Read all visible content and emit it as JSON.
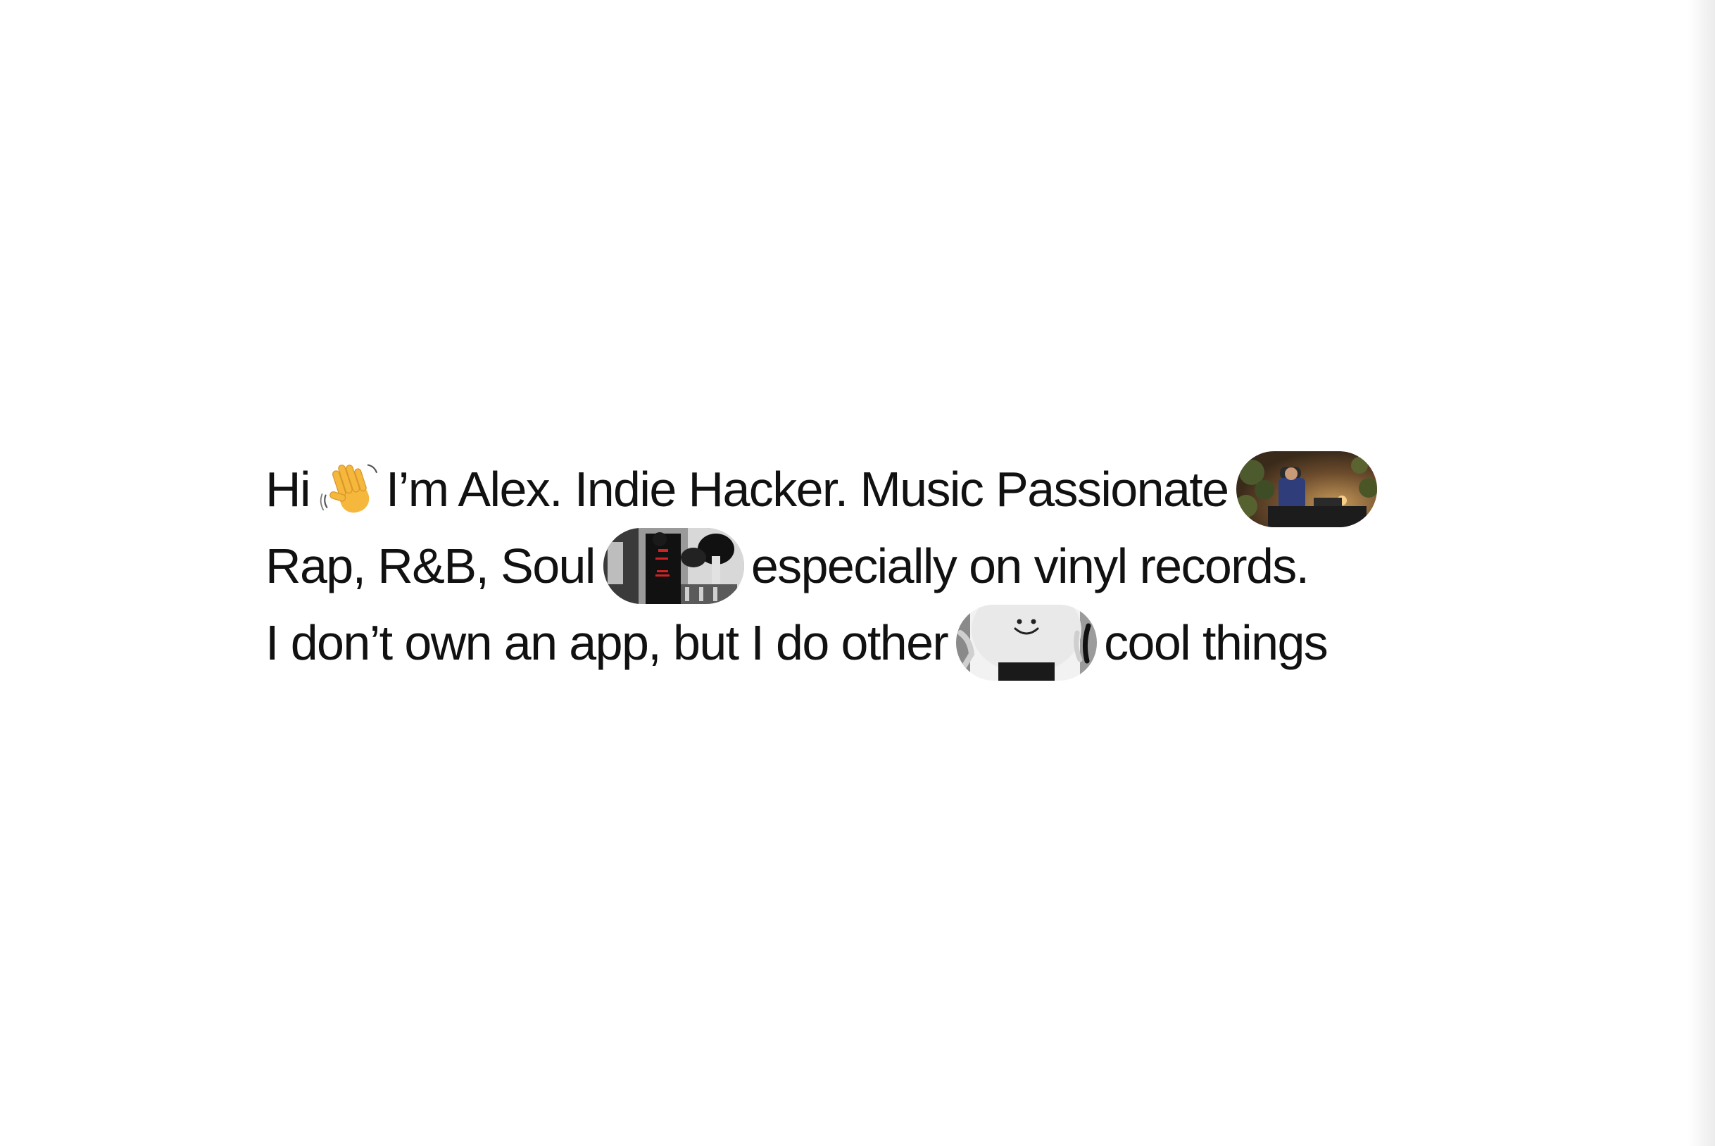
{
  "intro": {
    "line1": {
      "greeting": "Hi",
      "wave_icon": "waving-hand-icon",
      "text": "I’m Alex. Indie Hacker. Music Passionate",
      "image": "dj-booth-photo"
    },
    "line2": {
      "text_before": "Rap, R&B, Soul",
      "image": "vinyl-shop-photo",
      "text_after": "especially on vinyl records."
    },
    "line3": {
      "text_before": "I don’t own an app, but I do other",
      "image": "smiley-record-photo",
      "text_after": "cool things"
    }
  },
  "colors": {
    "text": "#111111",
    "background": "#ffffff",
    "wave_yellow": "#f5b83d"
  }
}
